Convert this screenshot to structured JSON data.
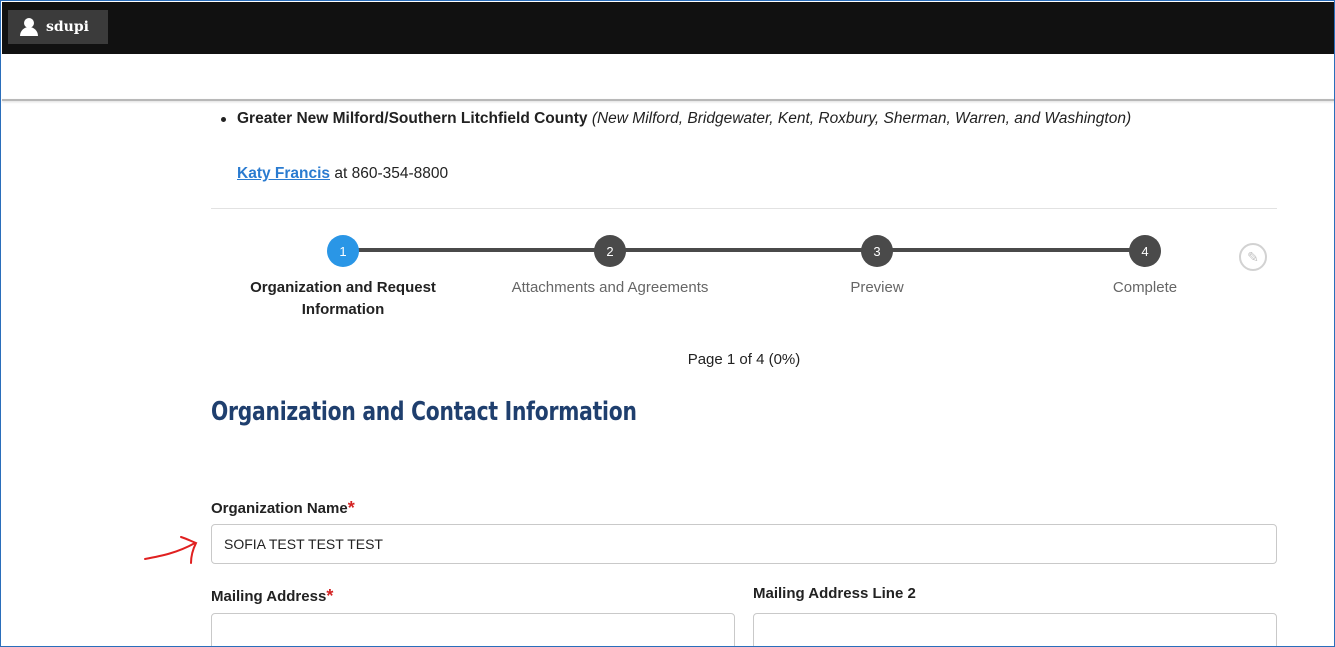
{
  "topbar": {
    "username": "sdupi",
    "user_icon": "user-icon"
  },
  "region": {
    "name": "Greater New Milford/Southern Litchfield County",
    "towns": "(New Milford, Bridgewater, Kent, Roxbury, Sherman, Warren, and Washington)",
    "contact_name": "Katy Francis",
    "contact_phone": "at 860-354-8800"
  },
  "stepper": {
    "steps": [
      {
        "number": "1",
        "label": "Organization and Request Information",
        "active": true
      },
      {
        "number": "2",
        "label": "Attachments and Agreements",
        "active": false
      },
      {
        "number": "3",
        "label": "Preview",
        "active": false
      },
      {
        "number": "4",
        "label": "Complete",
        "active": false
      }
    ],
    "edit_icon": "pencil-icon",
    "page_info": "Page 1 of 4 (0%)"
  },
  "form": {
    "section_title": "Organization and Contact Information",
    "org_name_label": "Organization Name",
    "org_name_value": "SOFIA TEST TEST TEST",
    "mailing_address_label": "Mailing Address",
    "mailing_address_value": "",
    "mailing_address2_label": "Mailing Address Line 2",
    "mailing_address2_value": "",
    "required_marker": "*"
  },
  "colors": {
    "topbar": "#111111",
    "accent_blue": "#2a96e6",
    "link": "#2a7bd0",
    "section_title": "#1f3f6e",
    "required": "#d32222",
    "annotation_arrow": "#e02020"
  }
}
